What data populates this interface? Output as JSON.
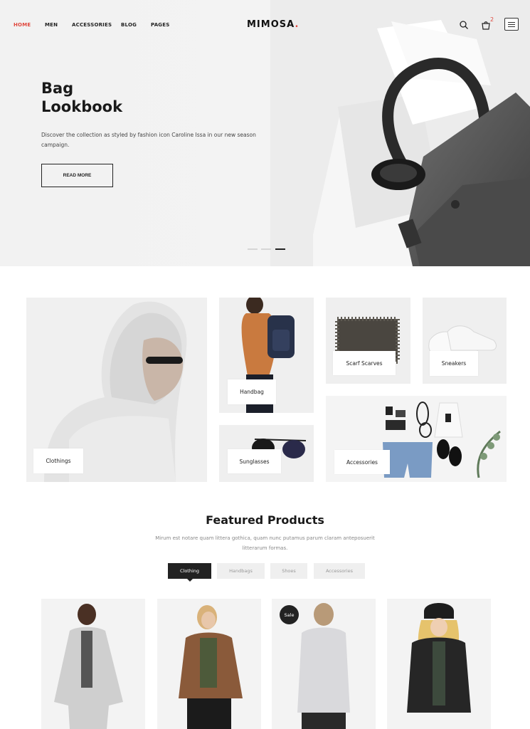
{
  "nav": {
    "items": [
      {
        "label": "HOME",
        "active": true
      },
      {
        "label": "MEN",
        "active": false
      },
      {
        "label": "ACCESSORIES",
        "active": false
      },
      {
        "label": "BLOG",
        "active": false
      },
      {
        "label": "PAGES",
        "active": false
      }
    ],
    "logo": "MIMOSA",
    "logo_dot": ".",
    "cart_count": "2",
    "icons": [
      "search-icon",
      "cart-icon",
      "menu-icon"
    ]
  },
  "hero": {
    "title_line1": "Bag",
    "title_line2": "Lookbook",
    "description": "Discover the collection as styled by fashion icon Caroline Issa in our new season campaign.",
    "button": "READ MORE",
    "active_slide": 3,
    "slide_count": 3
  },
  "categories": [
    {
      "label": "Clothings"
    },
    {
      "label": "Handbag"
    },
    {
      "label": "Scarf Scarves"
    },
    {
      "label": "Sneakers"
    },
    {
      "label": "Sunglasses"
    },
    {
      "label": "Accessories"
    }
  ],
  "featured": {
    "title": "Featured Products",
    "description": "Mirum est notare quam littera gothica, quam nunc putamus parum claram anteposuerit litterarum formas.",
    "tabs": [
      {
        "label": "Clothing",
        "active": true
      },
      {
        "label": "Handbags",
        "active": false
      },
      {
        "label": "Shoes",
        "active": false
      },
      {
        "label": "Accessories",
        "active": false
      }
    ],
    "products": [
      {
        "badge": ""
      },
      {
        "badge": ""
      },
      {
        "badge": "Sale"
      },
      {
        "badge": ""
      }
    ]
  },
  "colors": {
    "accent": "#e0483e",
    "dark": "#222222",
    "tile_bg": "#efefef"
  }
}
